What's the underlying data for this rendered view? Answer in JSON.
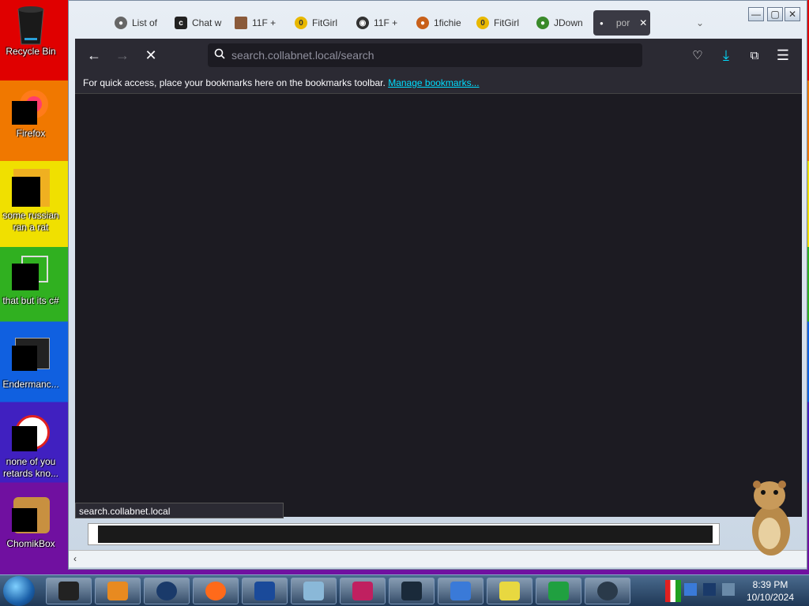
{
  "desktop": {
    "icons": [
      {
        "label": "Recycle Bin"
      },
      {
        "label": "Firefox"
      },
      {
        "label": "some russian ran a rat"
      },
      {
        "label": "that but its c#"
      },
      {
        "label": "Endermanc..."
      },
      {
        "label": "none of you retards kno..."
      },
      {
        "label": "ChomikBox"
      }
    ]
  },
  "browser": {
    "tabs": [
      {
        "label": "List of",
        "icon": "github-icon"
      },
      {
        "label": "Chat w",
        "icon": "chat-icon"
      },
      {
        "label": "11F +",
        "icon": "avatar-icon"
      },
      {
        "label": "FitGirl",
        "icon": "fitgirl-icon"
      },
      {
        "label": "11F +",
        "icon": "gamepad-icon"
      },
      {
        "label": "1fichie",
        "icon": "fichier-icon"
      },
      {
        "label": "FitGirl",
        "icon": "fitgirl-icon"
      },
      {
        "label": "JDown",
        "icon": "jdownloader-icon"
      },
      {
        "label": "por",
        "icon": "loading-dot-icon"
      }
    ],
    "url": "search.collabnet.local/search",
    "bookmarks_message": "For quick access, place your bookmarks here on the bookmarks toolbar.",
    "bookmarks_link": "Manage bookmarks...",
    "status_text": "search.collabnet.local",
    "accent_color": "#00ddff"
  },
  "taskbar": {
    "time": "8:39 PM",
    "date": "10/10/2024"
  }
}
